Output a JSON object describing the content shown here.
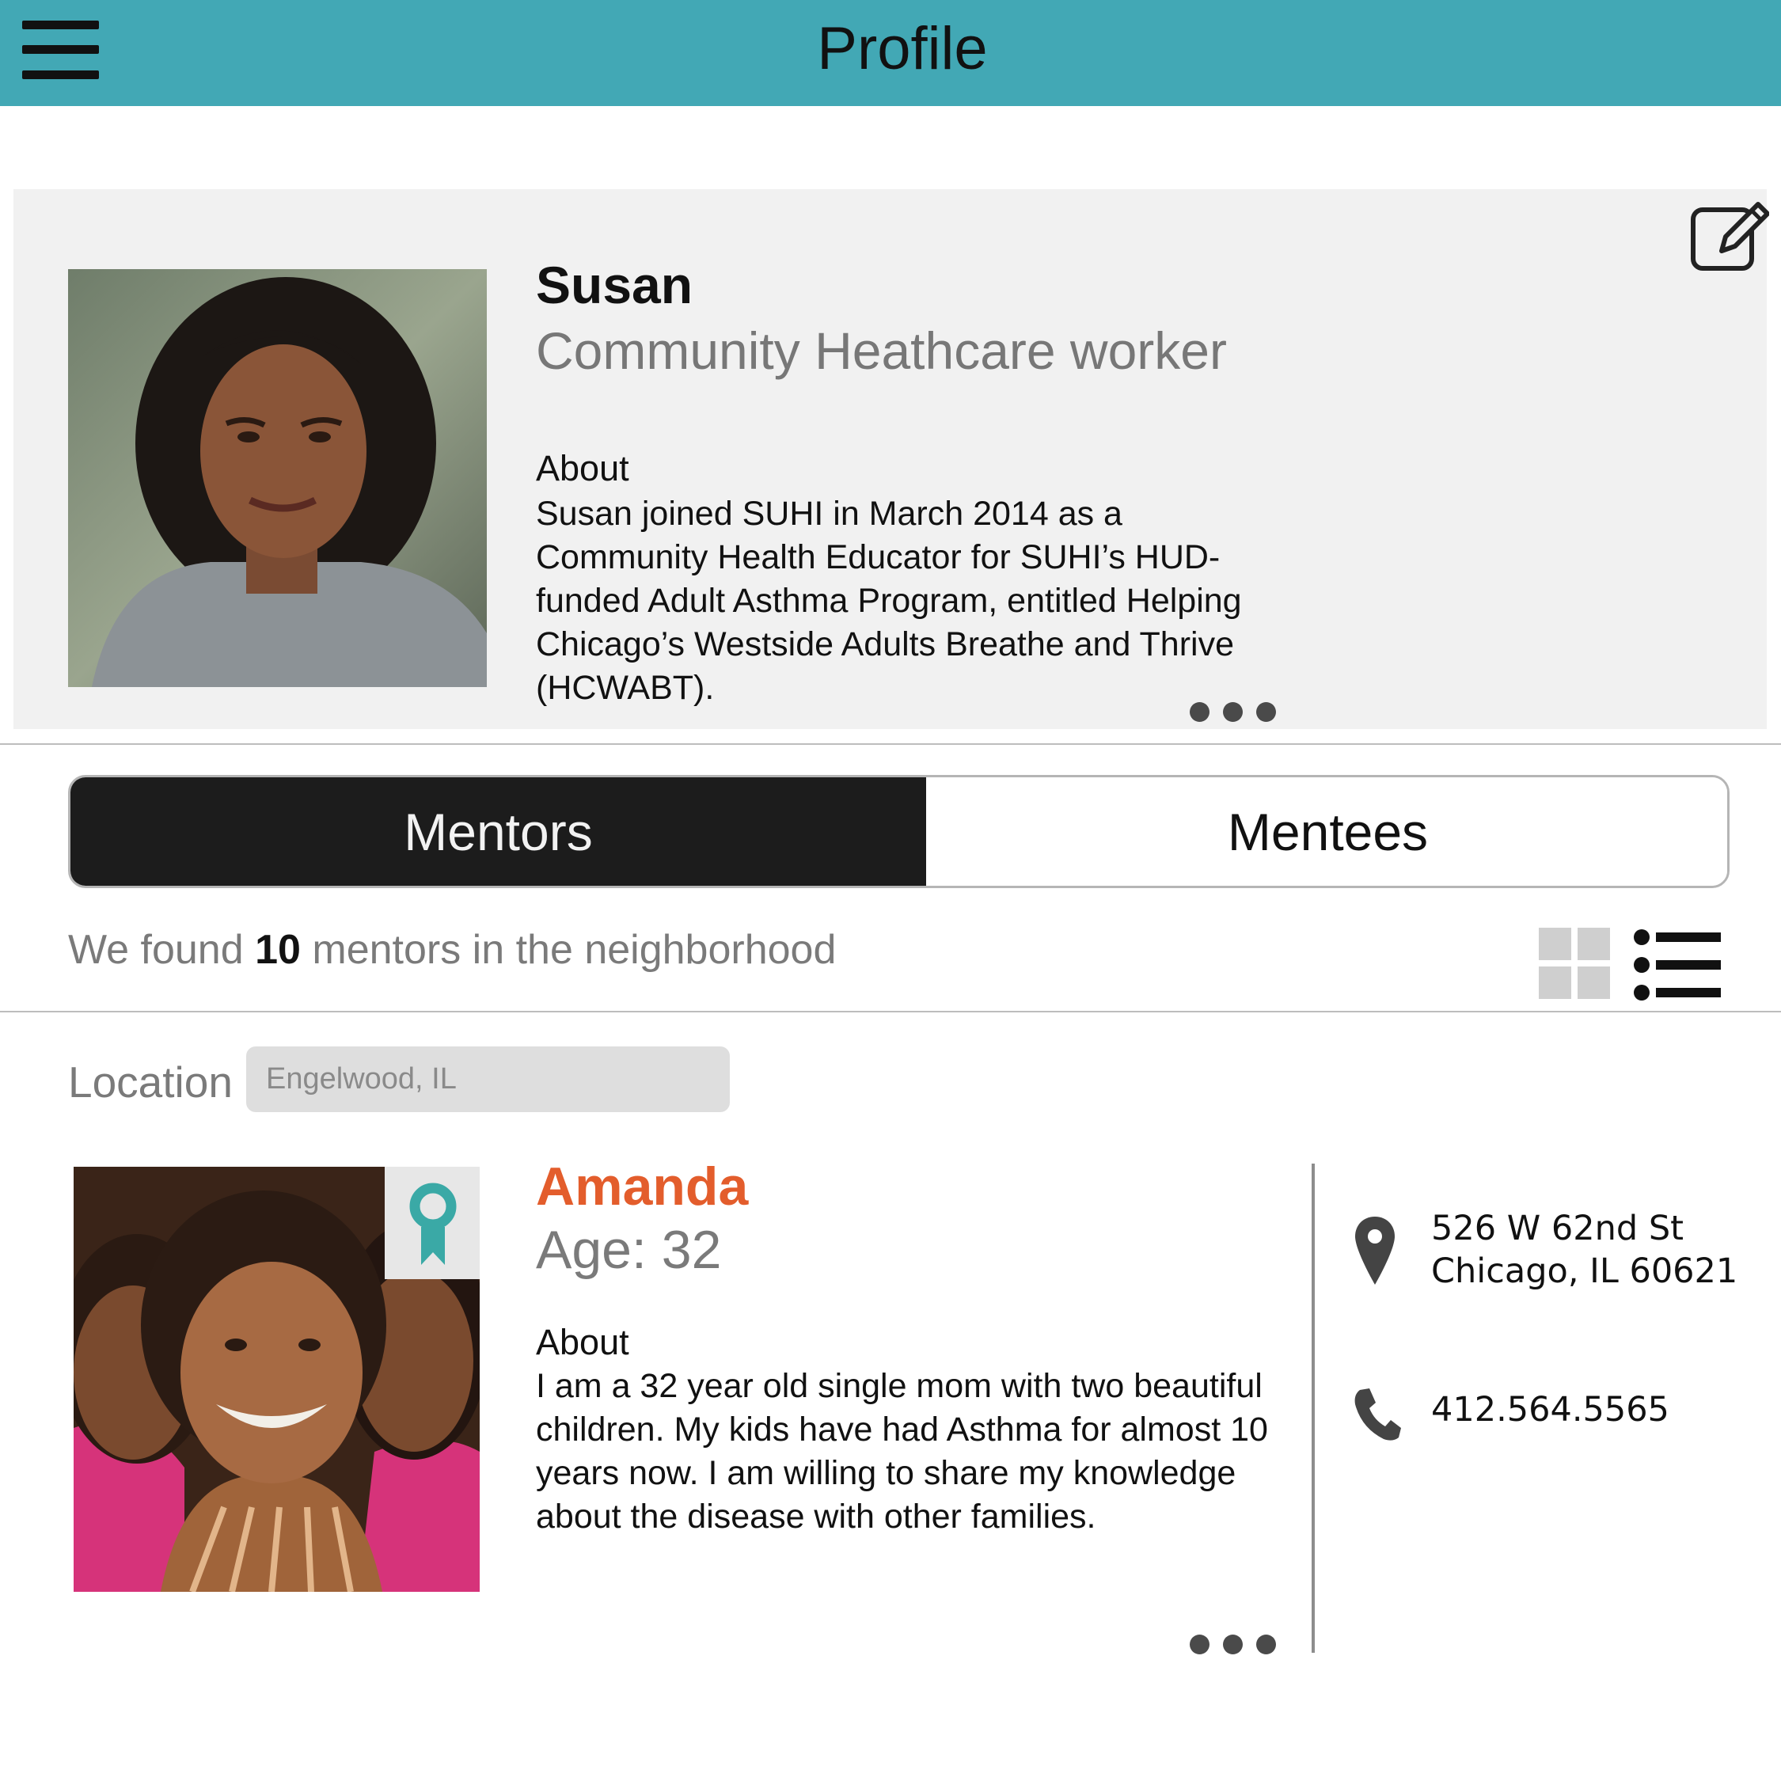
{
  "header": {
    "title": "Profile"
  },
  "profile": {
    "name": "Susan",
    "role": "Community Heathcare worker",
    "about_heading": "About",
    "about_text": "Susan joined SUHI in March 2014 as a Community Health Educator for SUHI’s HUD-funded Adult Asthma Program, entitled Helping Chicago’s Westside Adults Breathe and Thrive (HCWABT)."
  },
  "tabs": [
    {
      "label": "Mentors",
      "active": true
    },
    {
      "label": "Mentees",
      "active": false
    }
  ],
  "results": {
    "prefix": "We found ",
    "count": "10",
    "suffix": " mentors in the neighborhood"
  },
  "filter": {
    "location_label": "Location",
    "location_placeholder": "Engelwood, IL"
  },
  "mentor": {
    "name": "Amanda",
    "age": "Age: 32",
    "about_heading": "About",
    "about_text": "I am a 32 year old single mom with two beautiful children. My kids have had Asthma for almost 10 years now. I am willing to share my knowledge about the disease with other families.",
    "address_line1": "526 W 62nd St",
    "address_line2": "Chicago, IL 60621",
    "phone": "412.564.5565"
  },
  "colors": {
    "header_bg": "#42a8b5",
    "accent_name": "#e35d2c",
    "badge": "#3aa9a6",
    "tab_active_bg": "#1c1c1c"
  },
  "icons": [
    "menu-icon",
    "edit-icon",
    "more-icon",
    "grid-view-icon",
    "list-view-icon",
    "award-ribbon-icon",
    "location-pin-icon",
    "phone-icon"
  ]
}
